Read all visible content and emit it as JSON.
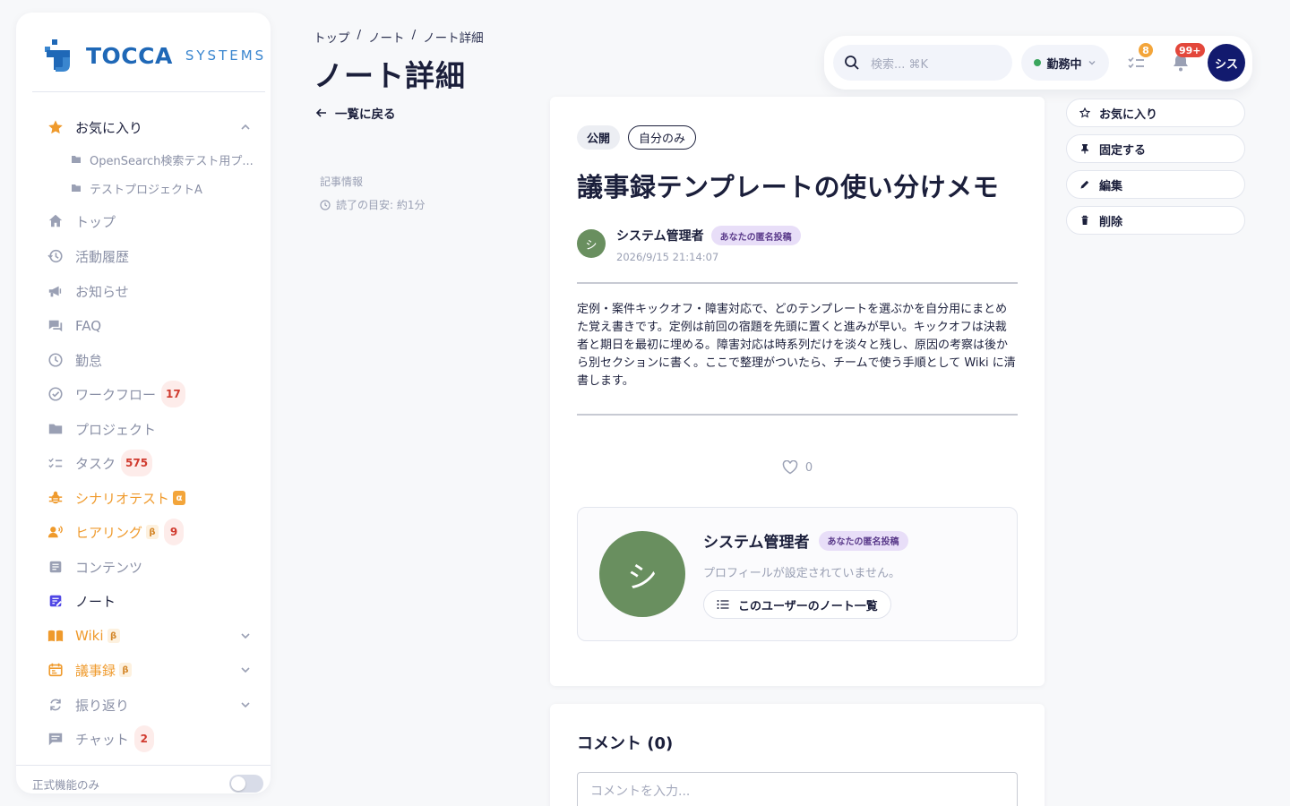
{
  "brand": {
    "name": "TOCCA",
    "suffix": "SYSTEMS"
  },
  "sidebar": {
    "items": [
      {
        "label": "お気に入り",
        "icon": "star-icon"
      },
      {
        "label": "OpenSearch検索テスト用プ...",
        "icon": "folder-icon"
      },
      {
        "label": "テストプロジェクトA",
        "icon": "folder-icon"
      },
      {
        "label": "トップ",
        "icon": "home-icon"
      },
      {
        "label": "活動履歴",
        "icon": "history-icon"
      },
      {
        "label": "お知らせ",
        "icon": "megaphone-icon"
      },
      {
        "label": "FAQ",
        "icon": "faq-icon"
      },
      {
        "label": "勤怠",
        "icon": "clock-icon"
      },
      {
        "label": "ワークフロー",
        "icon": "check-circle-icon",
        "badge": "17"
      },
      {
        "label": "プロジェクト",
        "icon": "folder-icon"
      },
      {
        "label": "タスク",
        "icon": "checklist-icon",
        "badge": "575"
      },
      {
        "label": "シナリオテスト",
        "icon": "bug-icon",
        "tag": "α"
      },
      {
        "label": "ヒアリング",
        "icon": "users-voice-icon",
        "tag": "β",
        "badge": "9"
      },
      {
        "label": "コンテンツ",
        "icon": "document-icon"
      },
      {
        "label": "ノート",
        "icon": "note-icon"
      },
      {
        "label": "Wiki",
        "icon": "book-icon",
        "tag": "β"
      },
      {
        "label": "議事録",
        "icon": "calendar-icon",
        "tag": "β"
      },
      {
        "label": "振り返り",
        "icon": "refresh-icon"
      },
      {
        "label": "チャット",
        "icon": "chat-icon",
        "badge": "2"
      }
    ],
    "footer_label": "正式機能のみ"
  },
  "breadcrumb": [
    "トップ",
    "ノート",
    "ノート詳細"
  ],
  "breadcrumb_sep": "/",
  "page_title": "ノート詳細",
  "back_label": "一覧に戻る",
  "meta": {
    "label": "記事情報",
    "read_time": "読了の目安: 約1分"
  },
  "topbar": {
    "search_placeholder": "検索... ⌘K",
    "status": "勤務中",
    "tasks_badge": "8",
    "notifications_badge": "99+",
    "avatar_initials": "シス"
  },
  "article": {
    "chips": [
      "公開",
      "自分のみ"
    ],
    "title": "議事録テンプレートの使い分けメモ",
    "author": {
      "initial": "シ",
      "name": "システム管理者",
      "badge": "あなたの匿名投稿",
      "date": "2026/9/15 21:14:07"
    },
    "body": "定例・案件キックオフ・障害対応で、どのテンプレートを選ぶかを自分用にまとめた覚え書きです。定例は前回の宿題を先頭に置くと進みが早い。キックオフは決裁者と期日を最初に埋める。障害対応は時系列だけを淡々と残し、原因の考察は後から別セクションに書く。ここで整理がついたら、チームで使う手順として Wiki に清書します。",
    "likes": "0",
    "profile": {
      "initial": "シ",
      "name": "システム管理者",
      "badge": "あなたの匿名投稿",
      "description": "プロフィールが設定されていません。",
      "button": "このユーザーのノート一覧"
    }
  },
  "comments": {
    "title": "コメント (0)",
    "placeholder": "コメントを入力..."
  },
  "actions": [
    {
      "label": "お気に入り",
      "icon": "star-outline-icon"
    },
    {
      "label": "固定する",
      "icon": "pin-icon"
    },
    {
      "label": "編集",
      "icon": "pencil-icon"
    },
    {
      "label": "削除",
      "icon": "trash-icon"
    }
  ],
  "colors": {
    "brand": "#1f68b7",
    "accent_orange": "#ef9a2c",
    "status_green": "#3aa55d",
    "avatar_navy": "#121a6e",
    "user_avatar": "#698f5f",
    "badge_purple": "#e8def8"
  }
}
